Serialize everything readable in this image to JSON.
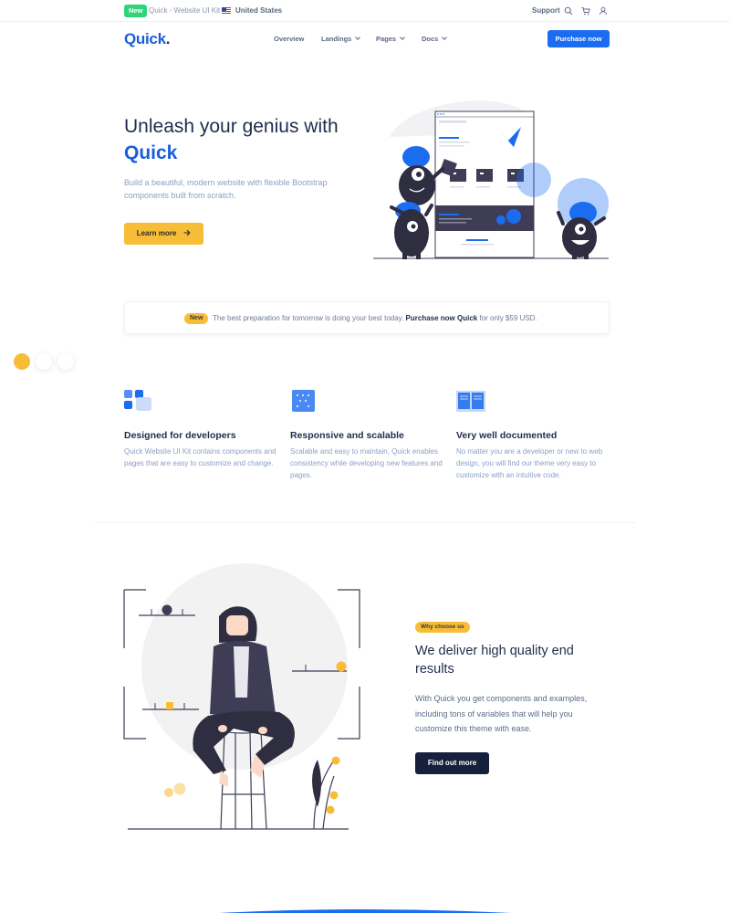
{
  "topbar": {
    "badge": "New",
    "product": "Quick - Website UI Kit",
    "country": "United States",
    "support": "Support",
    "icons": [
      "search-icon",
      "cart-icon",
      "user-icon"
    ]
  },
  "nav": {
    "logo_main": "Quick",
    "logo_dot": ".",
    "items": [
      {
        "label": "Overview",
        "dropdown": false
      },
      {
        "label": "Landings",
        "dropdown": true
      },
      {
        "label": "Pages",
        "dropdown": true
      },
      {
        "label": "Docs",
        "dropdown": true
      }
    ],
    "cta": "Purchase now"
  },
  "hero": {
    "title": "Unleash your genius with",
    "title_accent": "Quick",
    "subtitle": "Build a beautiful, modern website with flexible Bootstrap components built from scratch.",
    "button": "Learn more",
    "button_icon": "arrow-right-icon"
  },
  "banner": {
    "badge": "New",
    "text": "The best preparation for tomorrow is doing your best today.",
    "link": "Purchase now Quick",
    "suffix": "for only $59 USD."
  },
  "features": [
    {
      "icon": "grid-icon",
      "title": "Designed for developers",
      "text": "Quick Website UI Kit contains components and pages that are easy to customize and change."
    },
    {
      "icon": "dots-icon",
      "title": "Responsive and scalable",
      "text": "Scalable and easy to maintain, Quick enables consistency while developing new features and pages."
    },
    {
      "icon": "book-icon",
      "title": "Very well documented",
      "text": "No matter you are a developer or new to web design, you will find our theme very easy to customize with an intuitive code."
    }
  ],
  "why": {
    "badge": "Why choose us",
    "title": "We deliver high quality end results",
    "text": "With Quick you get components and examples, including tons of variables that will help you customize this theme with ease.",
    "button": "Find out more"
  },
  "colors": {
    "primary": "#1c6cf0",
    "accent": "#f8bd36",
    "dark": "#15203c",
    "success": "#2ed57a"
  }
}
